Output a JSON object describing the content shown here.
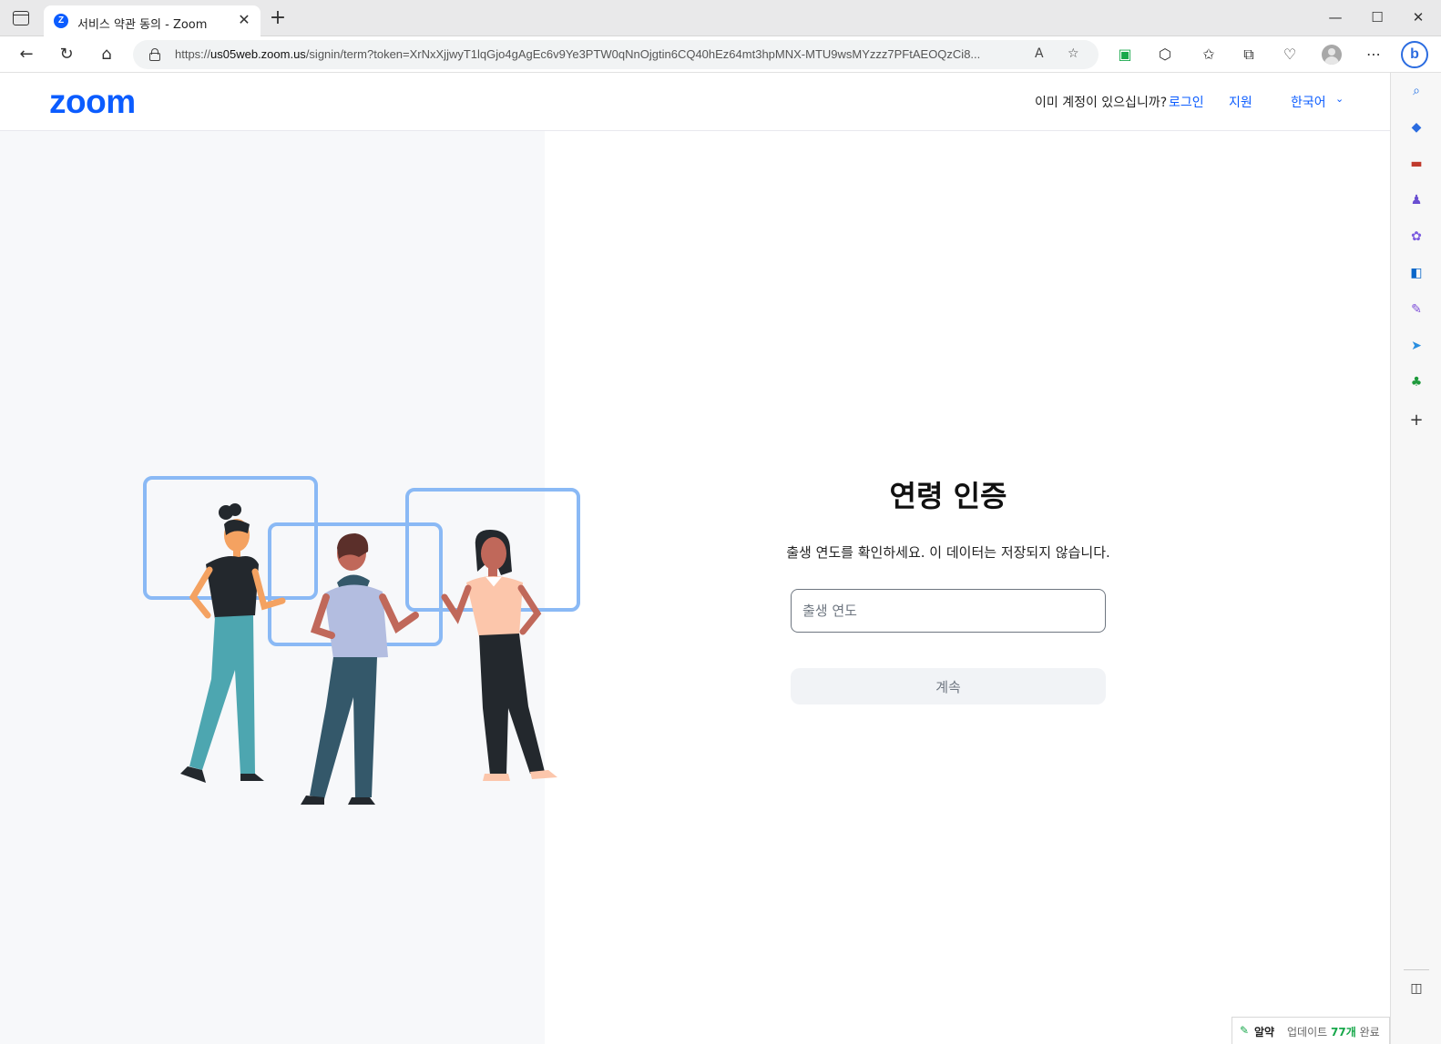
{
  "browser": {
    "tab_title": "서비스 약관 동의 - Zoom",
    "tab_favicon_letter": "Z",
    "url_prefix": "https://",
    "url_host": "us05web.zoom.us",
    "url_rest": "/signin/term?token=XrNxXjjwyT1lqGjo4gAgEc6v9Ye3PTW0qNnOjgtin6CQ40hEz64mt3hpMNX-MTU9wsMYzzz7PFtAEOQzCi8...",
    "read_aloud_label": "A"
  },
  "header": {
    "logo_text": "zoom",
    "account_question": "이미 계정이 있으십니까?",
    "login_label": "로그인",
    "support_label": "지원",
    "language_label": "한국어"
  },
  "main": {
    "title": "연령 인증",
    "description": "출생 연도를 확인하세요. 이 데이터는 저장되지 않습니다.",
    "year_placeholder": "출생 연도",
    "year_value": "",
    "continue_label": "계속"
  },
  "toast": {
    "brand": "알약",
    "prefix": "업데이트",
    "count": "77개",
    "suffix": "완료"
  },
  "colors": {
    "brand_blue": "#0b5cff",
    "frame_blue": "#8ab9f5",
    "panel_bg": "#f7f8fa",
    "button_bg": "#f1f3f6"
  }
}
